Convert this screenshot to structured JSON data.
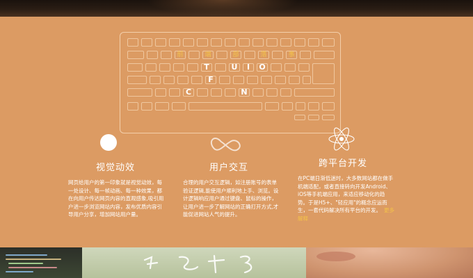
{
  "keyboard": {
    "cjk_keys": [
      "前",
      "端",
      "部",
      "落",
      "事"
    ],
    "letter_keys": [
      "T",
      "U",
      "I",
      "O",
      "F",
      "C",
      "N"
    ]
  },
  "features": [
    {
      "icon": "circle-icon",
      "title": "视觉动效",
      "body": "网页给用户的第一印象就是视觉动效，每一处设计、每一帧动画、每一种效果，都在向用户传达网页内容的直观感象,吸引用户进一步浏览网站内容，发布优质内容引导用户分享，增加网站用户量。"
    },
    {
      "icon": "infinity-icon",
      "title": "用户交互",
      "body": "合理的用户交互逻辑，如注册账号的表单验证逻辑,能使用户顺利地上手、浏览。设计逻辑响应用户通过键盘、鼠标的操作，让用户进一步了解网站的正确打开方式,才能促进网站人气的提升。"
    },
    {
      "icon": "atom-icon",
      "title": "跨平台开发",
      "body": "在PC端日渐低迷时，大多数网站都在做手机端适配，或者直接转向开发Android、iOS等手机端应用，来适应移动化的趋势。于是H5+、\"轻应用\"的概念应运而生，一套代码解决所有平台的开发。",
      "link": "更多解释"
    }
  ],
  "colors": {
    "background": "#dc9b63",
    "accent": "#f3c24a",
    "text": "#ffffff"
  }
}
